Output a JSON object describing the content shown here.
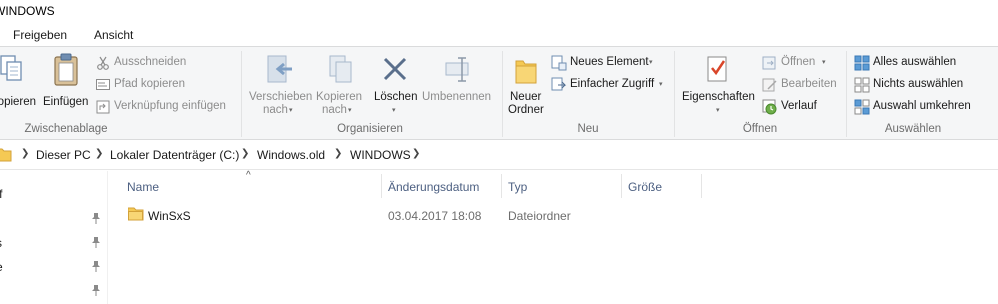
{
  "window": {
    "title": "WINDOWS"
  },
  "ribbon_tabs": [
    {
      "label": "Freigeben"
    },
    {
      "label": "Ansicht"
    }
  ],
  "clipboard": {
    "copy": "Kopieren",
    "paste": "Einfügen",
    "cut": "Ausschneiden",
    "copy_path": "Pfad kopieren",
    "paste_shortcut": "Verknüpfung einfügen",
    "group": "Zwischenablage"
  },
  "organize": {
    "move_line1": "Verschieben",
    "move_line2": "nach",
    "copy_line1": "Kopieren",
    "copy_line2": "nach",
    "delete": "Löschen",
    "rename": "Umbenennen",
    "group": "Organisieren"
  },
  "new": {
    "folder_line1": "Neuer",
    "folder_line2": "Ordner",
    "new_item": "Neues Element",
    "easy_access": "Einfacher Zugriff",
    "group": "Neu"
  },
  "open": {
    "properties": "Eigenschaften",
    "open": "Öffnen",
    "edit": "Bearbeiten",
    "history": "Verlauf",
    "group": "Öffnen"
  },
  "select": {
    "select_all": "Alles auswählen",
    "select_none": "Nichts auswählen",
    "invert": "Auswahl umkehren",
    "group": "Auswählen"
  },
  "breadcrumb": [
    "Dieser PC",
    "Lokaler Datenträger (C:)",
    "Windows.old",
    "WINDOWS"
  ],
  "navpane": {
    "items": [
      {
        "label": "ff"
      },
      {
        "label": ""
      },
      {
        "label": "s"
      },
      {
        "label": "e"
      },
      {
        "label": ""
      }
    ]
  },
  "columns": {
    "name": "Name",
    "date": "Änderungsdatum",
    "type": "Typ",
    "size": "Größe"
  },
  "files": [
    {
      "name": "WinSxS",
      "date": "03.04.2017 18:08",
      "type": "Dateiordner",
      "size": ""
    }
  ],
  "colors": {
    "ribbon_bg": "#f5f6f7",
    "header_text": "#4d6082",
    "folder": "#f5c954"
  }
}
